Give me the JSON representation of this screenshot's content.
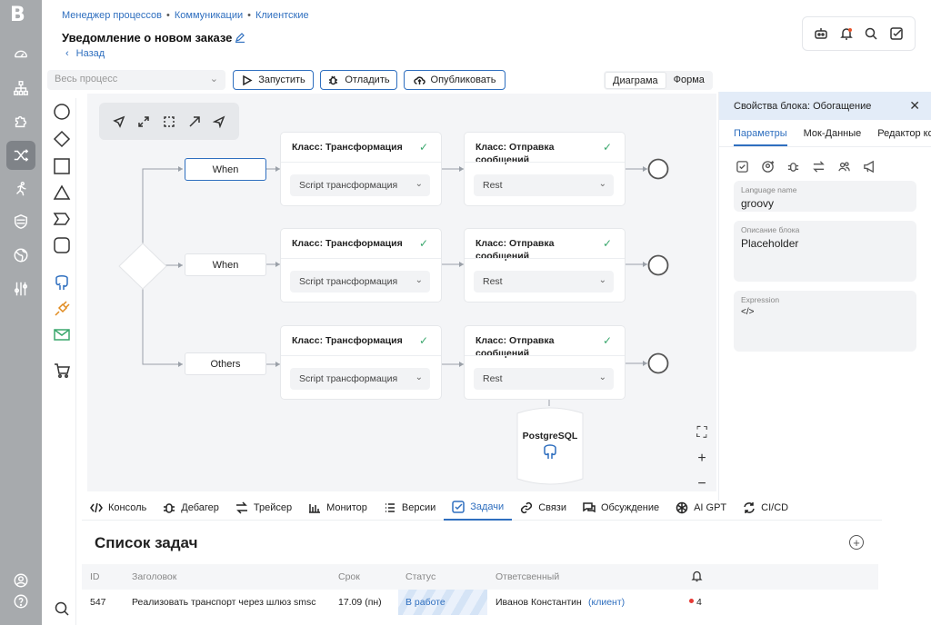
{
  "app": {
    "logo": "B"
  },
  "sidebar": {
    "items": [
      {
        "icon": "dashboard-icon"
      },
      {
        "icon": "hierarchy-icon"
      },
      {
        "icon": "puzzle-icon"
      },
      {
        "icon": "shuffle-icon",
        "active": true
      },
      {
        "icon": "runner-icon"
      },
      {
        "icon": "shield-icon"
      },
      {
        "icon": "globe-icon"
      },
      {
        "icon": "sliders-icon"
      }
    ],
    "bottom": [
      {
        "icon": "user-icon"
      },
      {
        "icon": "help-icon"
      }
    ]
  },
  "breadcrumb": [
    "Менеджер процессов",
    "Коммуникации",
    "Клиентские"
  ],
  "page": {
    "title": "Уведомление о новом заказе",
    "back": "Назад"
  },
  "header_icons": [
    "robot-icon",
    "bell-icon",
    "search-icon",
    "checkbox-icon"
  ],
  "toolbar": {
    "process_placeholder": "Весь процесс",
    "run": "Запустить",
    "debug": "Отладить",
    "publish": "Опубликовать",
    "view_diagram": "Диаграма",
    "view_form": "Форма"
  },
  "palette": [
    "circle-shape-icon",
    "diamond-shape-icon",
    "square-shape-icon",
    "triangle-shape-icon",
    "tag-shape-icon",
    "rounded-square-icon",
    "postgres-icon",
    "plug-icon",
    "imap-icon",
    "cart-icon"
  ],
  "canvas": {
    "tools": [
      "cursor-icon",
      "expand-icon",
      "select-icon",
      "arrow-icon",
      "send-icon"
    ],
    "branches": [
      {
        "condition": "When",
        "selected": true
      },
      {
        "condition": "When",
        "selected": false
      },
      {
        "condition": "Others",
        "selected": false
      }
    ],
    "transform_card": {
      "title": "Класс: Трансформация",
      "value": "Script трансформация"
    },
    "send_card": {
      "title": "Класс: Отправка сообщений",
      "value": "Rest"
    },
    "database": "PostgreSQL"
  },
  "props": {
    "title": "Свойства блока: Обогащение",
    "tabs": [
      "Параметры",
      "Мок-Данные",
      "Редактор кода"
    ],
    "active_tab": 0,
    "icons": [
      "check-square-icon",
      "user-add-icon",
      "bug-icon",
      "swap-icon",
      "users-icon",
      "megaphone-icon"
    ],
    "fields": [
      {
        "label": "Language name",
        "value": "groovy"
      },
      {
        "label": "Описание блока",
        "value": "Placeholder"
      },
      {
        "label": "Expression",
        "value": "</>"
      }
    ]
  },
  "bottom_tabs": [
    {
      "label": "Консоль",
      "icon": "code-icon"
    },
    {
      "label": "Дебагер",
      "icon": "bug-icon"
    },
    {
      "label": "Трейсер",
      "icon": "swap-icon"
    },
    {
      "label": "Монитор",
      "icon": "bar-chart-icon"
    },
    {
      "label": "Версии",
      "icon": "list-icon"
    },
    {
      "label": "Задачи",
      "icon": "check-square-icon",
      "active": true
    },
    {
      "label": "Связи",
      "icon": "link-icon"
    },
    {
      "label": "Обсуждение",
      "icon": "chat-icon"
    },
    {
      "label": "AI GPT",
      "icon": "openai-icon"
    },
    {
      "label": "CI/CD",
      "icon": "refresh-icon"
    }
  ],
  "tasks": {
    "title": "Список задач",
    "columns": [
      "ID",
      "Заголовок",
      "Срок",
      "Статус",
      "Ответсвенный"
    ],
    "rows": [
      {
        "id": "547",
        "title": "Реализовать транспорт через шлюз smsc",
        "due": "17.09 (пн)",
        "status": "В работе",
        "owner": "Иванов  Константин",
        "owner_role": "(клиент)",
        "notifications": "4"
      }
    ]
  },
  "colors": {
    "accent": "#2f6fbf",
    "sidebar": "#a7aaad",
    "success": "#3aa76d",
    "alert": "#e53935"
  }
}
